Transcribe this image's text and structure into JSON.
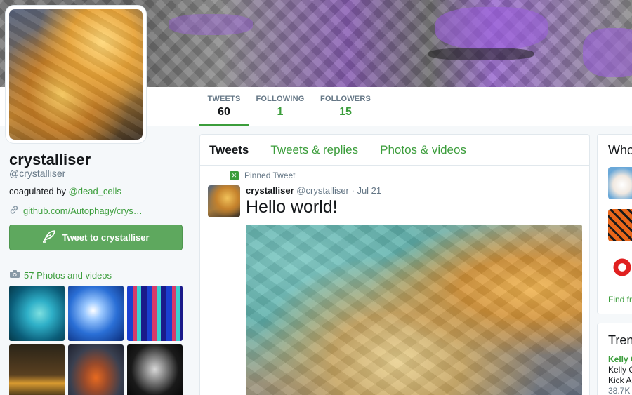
{
  "profile": {
    "name": "crystalliser",
    "handle": "@crystalliser",
    "bio_prefix": "coagulated by ",
    "bio_mention": "@dead_cells",
    "link": "github.com/Autophagy/crys…",
    "tweet_to_label": "Tweet to crystalliser",
    "photos_label": "57 Photos and videos"
  },
  "stats": [
    {
      "label": "TWEETS",
      "value": "60"
    },
    {
      "label": "FOLLOWING",
      "value": "1"
    },
    {
      "label": "FOLLOWERS",
      "value": "15"
    }
  ],
  "timeline": {
    "tabs": [
      {
        "label": "Tweets"
      },
      {
        "label": "Tweets & replies"
      },
      {
        "label": "Photos & videos"
      }
    ],
    "pinned_label": "Pinned Tweet",
    "tweet": {
      "name": "crystalliser",
      "handle": "@crystalliser",
      "date": "· Jul 21",
      "text": "Hello world!"
    }
  },
  "sidebar": {
    "who_title": "Who",
    "find_label": "Find fri",
    "trends_title": "Trend",
    "trend_lines": [
      "Kelly C",
      "Kelly C",
      "Kick A",
      "38.7K"
    ]
  },
  "colors": {
    "accent": "#3b9d3b",
    "button": "#5ea85e",
    "muted": "#657786",
    "background": "#f5f8fa"
  },
  "icons": {
    "link": "link-icon",
    "camera": "camera-icon",
    "quill": "quill-icon",
    "pin": "pin-icon"
  }
}
